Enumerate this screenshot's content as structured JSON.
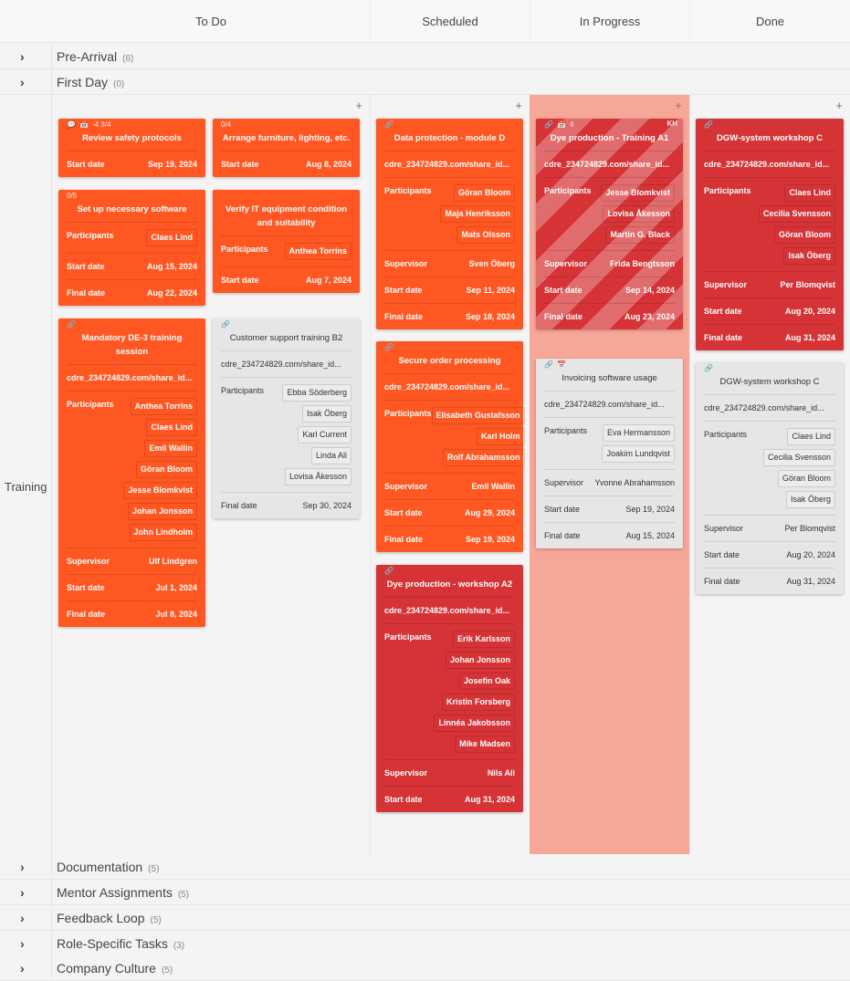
{
  "columns": [
    {
      "label": "To Do"
    },
    {
      "label": "Scheduled"
    },
    {
      "label": "In Progress"
    },
    {
      "label": "Done"
    }
  ],
  "lanes_top": [
    {
      "name": "Pre-Arrival",
      "count": "(6)"
    },
    {
      "name": "First Day",
      "count": "(0)"
    }
  ],
  "active_lane": {
    "name": "Training"
  },
  "lanes_bottom": [
    {
      "name": "Documentation",
      "count": "(5)"
    },
    {
      "name": "Mentor Assignments",
      "count": "(5)"
    },
    {
      "name": "Feedback Loop",
      "count": "(5)"
    },
    {
      "name": "Role-Specific Tasks",
      "count": "(3)"
    },
    {
      "name": "Company Culture",
      "count": "(5)"
    }
  ],
  "icons": {
    "add": "+",
    "chevron": "›",
    "link": "🔗",
    "calendar": "📅",
    "comment": "💬"
  },
  "labels": {
    "participants": "Participants",
    "supervisor": "Supervisor",
    "start": "Start date",
    "final": "Final date"
  },
  "cards": {
    "c1": {
      "meta": "-4  3/4",
      "title": "Review safety protocols",
      "start": "Sep 19, 2024"
    },
    "c2": {
      "meta": "0/4",
      "title": "Arrange furniture, lighting, etc.",
      "start": "Aug 8, 2024"
    },
    "c3": {
      "meta": "0/5",
      "title": "Set up necessary software",
      "participants": [
        "Claes Lind"
      ],
      "start": "Aug 15, 2024",
      "final": "Aug 22, 2024"
    },
    "c4": {
      "title": "Verify IT equipment condition and suitability",
      "participants": [
        "Anthea Torrins"
      ],
      "start": "Aug 7, 2024"
    },
    "c5": {
      "title": "Mandatory DE-3 training session",
      "link": "cdre_234724829.com/share_id...",
      "participants": [
        "Anthea Torrins",
        "Claes Lind",
        "Emil Wallin",
        "Göran Bloom",
        "Jesse Blomkvist",
        "Johan Jonsson",
        "John Lindholm"
      ],
      "supervisor": "Ulf Lindgren",
      "start": "Jul 1, 2024",
      "final": "Jul 8, 2024"
    },
    "c6": {
      "title": "Customer support training B2",
      "link": "cdre_234724829.com/share_id...",
      "participants": [
        "Ebba Söderberg",
        "Isak Öberg",
        "Karl Current",
        "Linda Ali",
        "Lovisa Åkesson"
      ],
      "final": "Sep 30, 2024"
    },
    "c7": {
      "title": "Data protection - module D",
      "link": "cdre_234724829.com/share_id...",
      "participants": [
        "Göran Bloom",
        "Maja Henriksson",
        "Mats Olsson"
      ],
      "supervisor": "Sven Öberg",
      "start": "Sep 11, 2024",
      "final": "Sep 18, 2024"
    },
    "c8": {
      "title": "Secure order processing",
      "link": "cdre_234724829.com/share_id...",
      "participants": [
        "Elisabeth Gustafsson",
        "Karl Holm",
        "Rolf Abrahamsson"
      ],
      "supervisor": "Emil Wallin",
      "start": "Aug 29, 2024",
      "final": "Sep 19, 2024"
    },
    "c9": {
      "title": "Dye production - workshop A2",
      "link": "cdre_234724829.com/share_id...",
      "participants": [
        "Erik Karlsson",
        "Johan Jonsson",
        "Josefin Oak",
        "Kristin Forsberg",
        "Linnéa Jakobsson",
        "Mike Madsen"
      ],
      "supervisor": "Nils Ali",
      "start": "Aug 31, 2024"
    },
    "c10": {
      "meta": "4",
      "badge": "KH",
      "title": "Dye production - Training A1",
      "link": "cdre_234724829.com/share_id...",
      "participants": [
        "Jesse Blomkvist",
        "Lovisa Åkesson",
        "Martin G. Black"
      ],
      "supervisor": "Frida Bengtsson",
      "start": "Sep 14, 2024",
      "final": "Aug 23, 2024"
    },
    "c11": {
      "title": "Invoicing software usage",
      "link": "cdre_234724829.com/share_id...",
      "participants": [
        "Eva Hermansson",
        "Joakim Lundqvist"
      ],
      "supervisor": "Yvonne Abrahamsson",
      "start": "Sep 19, 2024",
      "final": "Aug 15, 2024"
    },
    "c12": {
      "title": "DGW-system workshop C",
      "link": "cdre_234724829.com/share_id...",
      "participants": [
        "Claes Lind",
        "Cecilia Svensson",
        "Göran Bloom",
        "Isak Öberg"
      ],
      "supervisor": "Per Blomqvist",
      "start": "Aug 20, 2024",
      "final": "Aug 31, 2024"
    },
    "c13": {
      "title": "DGW-system workshop C",
      "link": "cdre_234724829.com/share_id...",
      "participants": [
        "Claes Lind",
        "Cecilia Svensson",
        "Göran Bloom",
        "Isak Öberg"
      ],
      "supervisor": "Per Blomqvist",
      "start": "Aug 20, 2024",
      "final": "Aug 31, 2024"
    }
  }
}
